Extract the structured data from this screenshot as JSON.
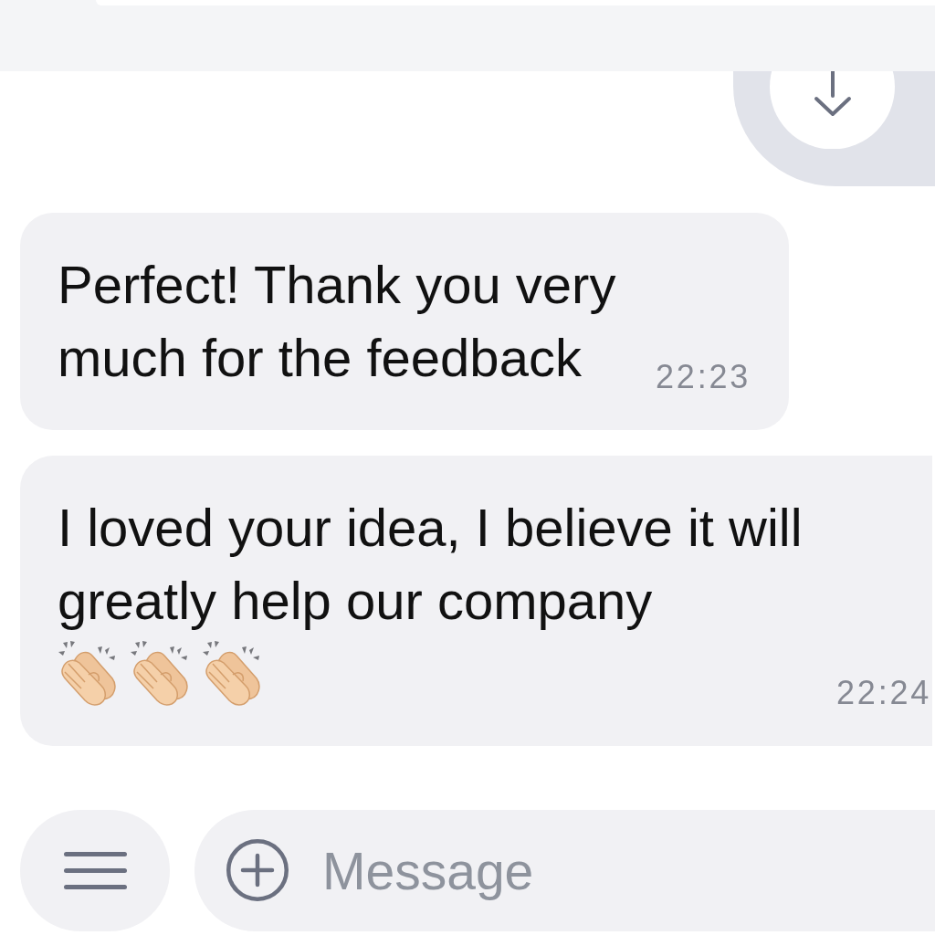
{
  "messages": [
    {
      "text": "Perfect! Thank you very much for the feedback",
      "time": "22:23"
    },
    {
      "text": "I loved your idea, I believe it will greatly help our company",
      "emojis": [
        {
          "kind": "clap"
        },
        {
          "kind": "clap"
        },
        {
          "kind": "clap"
        }
      ],
      "time": "22:24"
    }
  ],
  "composer": {
    "placeholder": "Message"
  }
}
